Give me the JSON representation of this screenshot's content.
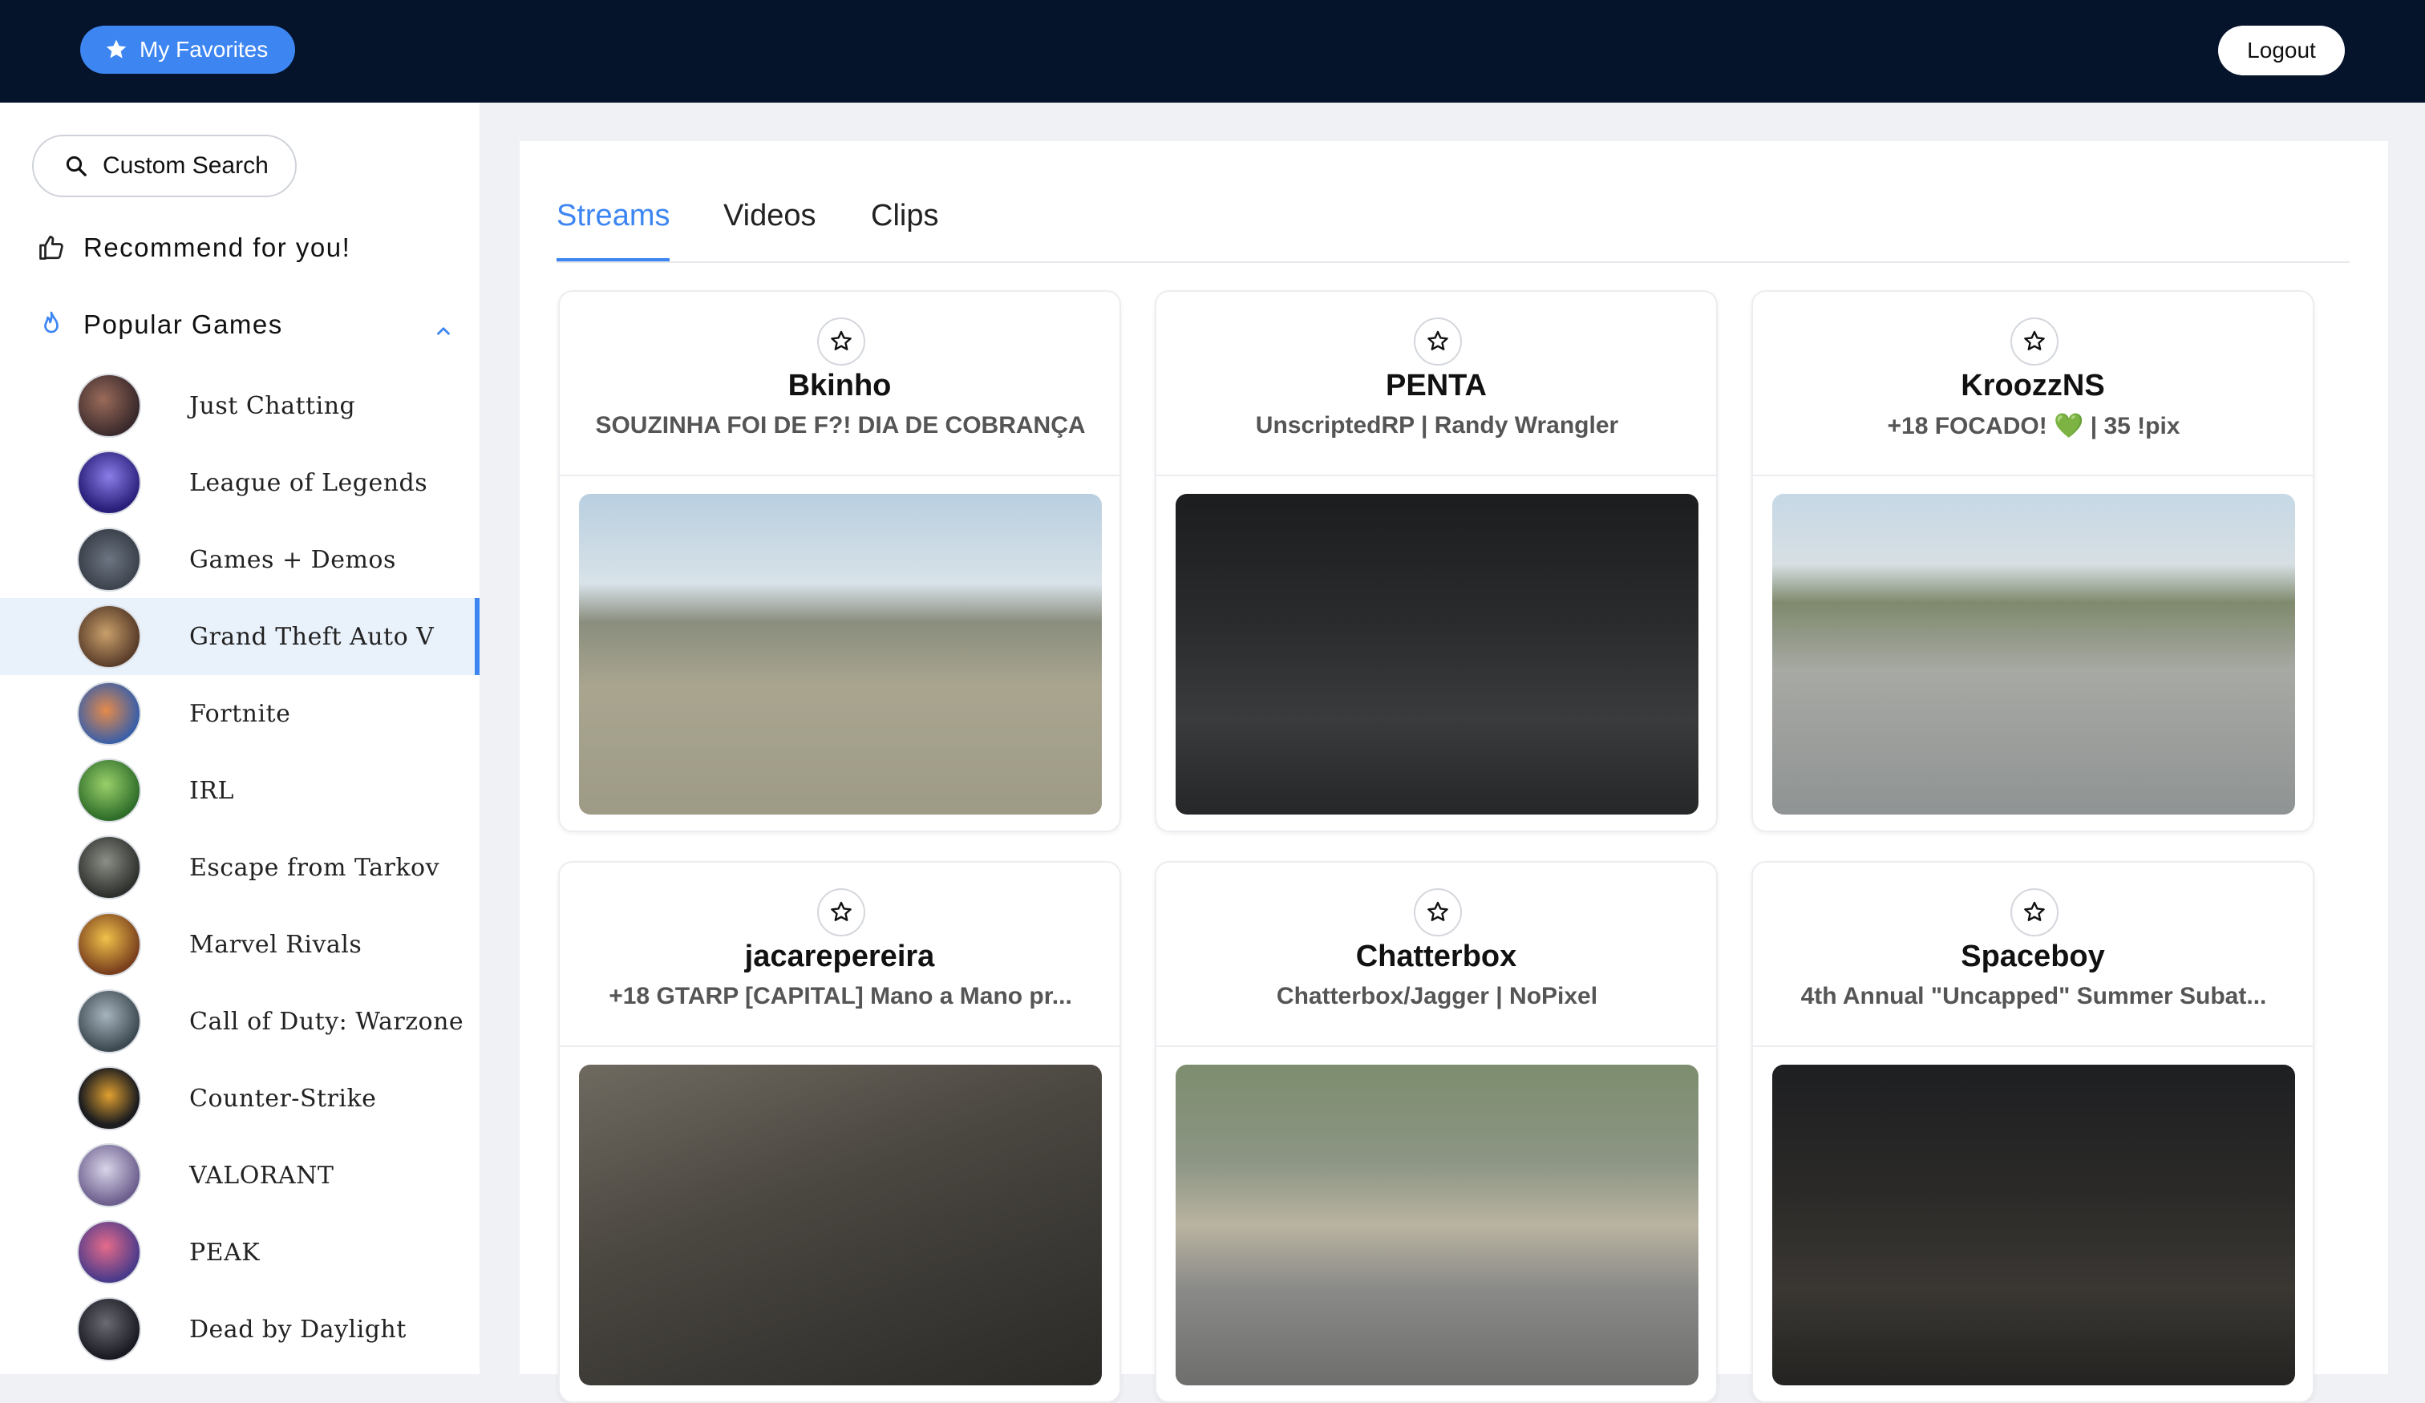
{
  "header": {
    "favorites_label": "My Favorites",
    "logout_label": "Logout"
  },
  "sidebar": {
    "custom_search_label": "Custom Search",
    "recommend_label": "Recommend for you!",
    "popular_games_label": "Popular Games",
    "games": [
      {
        "label": "Just Chatting",
        "active": false
      },
      {
        "label": "League of Legends",
        "active": false
      },
      {
        "label": "Games + Demos",
        "active": false
      },
      {
        "label": "Grand Theft Auto V",
        "active": true
      },
      {
        "label": "Fortnite",
        "active": false
      },
      {
        "label": "IRL",
        "active": false
      },
      {
        "label": "Escape from Tarkov",
        "active": false
      },
      {
        "label": "Marvel Rivals",
        "active": false
      },
      {
        "label": "Call of Duty: Warzone",
        "active": false
      },
      {
        "label": "Counter-Strike",
        "active": false
      },
      {
        "label": "VALORANT",
        "active": false
      },
      {
        "label": "PEAK",
        "active": false
      },
      {
        "label": "Dead by Daylight",
        "active": false
      }
    ]
  },
  "tabs": [
    {
      "label": "Streams",
      "active": true
    },
    {
      "label": "Videos",
      "active": false
    },
    {
      "label": "Clips",
      "active": false
    }
  ],
  "streams": [
    {
      "channel": "Bkinho",
      "title": "SOUZINHA FOI DE F?! DIA DE COBRANÇA"
    },
    {
      "channel": "PENTA",
      "title": "UnscriptedRP | Randy Wrangler"
    },
    {
      "channel": "KroozzNS",
      "title": "+18 FOCADO! 💚 | 35 !pix"
    },
    {
      "channel": "jacarepereira",
      "title": "+18 GTARP [CAPITAL] Mano a Mano pr..."
    },
    {
      "channel": "Chatterbox",
      "title": "Chatterbox/Jagger | NoPixel"
    },
    {
      "channel": "Spaceboy",
      "title": "4th Annual \"Uncapped\" Summer Subat..."
    }
  ],
  "colors": {
    "topbar": "#05132b",
    "accent": "#3d86f2",
    "sidebar_active_bg": "#e9f1fb"
  }
}
